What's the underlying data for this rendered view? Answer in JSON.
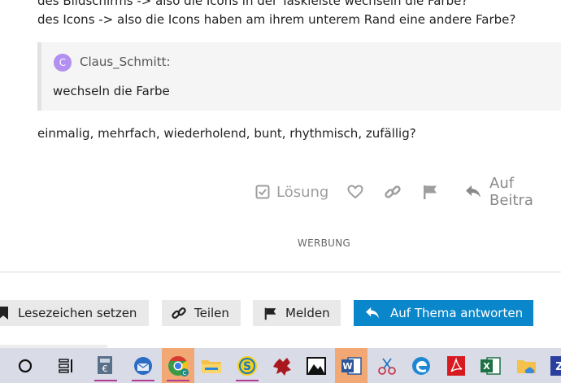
{
  "post": {
    "line1": "des Bildschirms -> also die Icons in der Taskleiste wechseln die Farbe?",
    "line2": "des Icons -> also die Icons haben am ihrem unterem Rand eine andere Farbe?",
    "quote": {
      "avatar_letter": "C",
      "author": "Claus_Schmitt:",
      "text": "wechseln die Farbe"
    },
    "line3": "einmalig, mehrfach, wiederholend, bunt, rhythmisch, zufällig?"
  },
  "post_actions": {
    "solution_label": "Lösung",
    "reply_label": "Auf Beitra"
  },
  "ad_label": "WERBUNG",
  "topic_buttons": {
    "bookmark": "Lesezeichen setzen",
    "share": "Teilen",
    "flag": "Melden",
    "reply": "Auf Thema antworten"
  },
  "taskbar": {
    "active_items": [
      "chrome",
      "word"
    ],
    "underlined_items": [
      "calculator",
      "thunderbird",
      "chrome",
      "s-app"
    ]
  },
  "colors": {
    "primary_button": "#0a87ca",
    "avatar": "#b28ff0",
    "taskbar_bg": "#d9dbe6",
    "taskbar_active": "#f1a875",
    "taskbar_underline": "#b03a9a"
  }
}
